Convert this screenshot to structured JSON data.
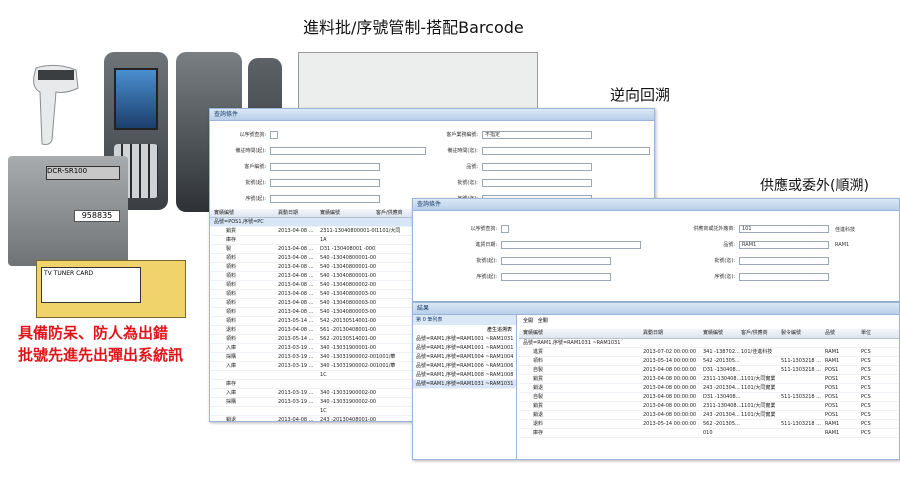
{
  "title": "進料批/序號管制-搭配Barcode",
  "captions": {
    "reverse": "逆向回溯",
    "forward": "供應或委外(順溯)"
  },
  "red_text": {
    "line1": "具備防呆、防人為出錯",
    "line2": "批號先進先出彈出系統訊"
  },
  "photos": {
    "camera_tag": "DCR-SR100",
    "camera_serial": "958835",
    "card_label": "TV TUNER CARD"
  },
  "win1": {
    "title": "查詢條件",
    "fields_left": [
      "以序號查詢:",
      "備註時間(起):",
      "客戶編號:",
      "批號(起):",
      "序號(起):"
    ],
    "fields_right": [
      "客戶業務編號:",
      "備註時間(迄):",
      "品號:",
      "批號(迄):",
      "序號(迄):"
    ],
    "right_value": "不指定",
    "columns": [
      "實績編號",
      "異動日期",
      "實績編號",
      "客戶/供應商"
    ],
    "rows": [
      {
        "name": "品號=POS1,序號=PC",
        "date": "",
        "no": "",
        "cust": ""
      },
      {
        "name": "銷貨",
        "date": "2013-04-08 ...",
        "no": "2311-13040800001-0001",
        "cust": "1101/大同"
      },
      {
        "name": "庫存",
        "date": "",
        "no": "1A",
        "cust": ""
      },
      {
        "name": "製",
        "date": "2013-04-08 ...",
        "no": "D31 -130408001 -0001",
        "cust": ""
      },
      {
        "name": "領料",
        "date": "2013-04-08 ...",
        "no": "540 -13040800001-0001",
        "cust": ""
      },
      {
        "name": "領料",
        "date": "2013-04-08 ...",
        "no": "540 -13040800001-0002",
        "cust": ""
      },
      {
        "name": "領料",
        "date": "2013-04-08 ...",
        "no": "540 -13040800001-0003",
        "cust": ""
      },
      {
        "name": "領料",
        "date": "2013-04-08 ...",
        "no": "540 -13040800002-0001",
        "cust": ""
      },
      {
        "name": "領料",
        "date": "2013-04-08 ...",
        "no": "540 -13040800003-0001",
        "cust": ""
      },
      {
        "name": "領料",
        "date": "2013-04-08 ...",
        "no": "540 -13040800003-0002",
        "cust": ""
      },
      {
        "name": "領料",
        "date": "2013-04-08 ...",
        "no": "540 -13040800003-0003",
        "cust": ""
      },
      {
        "name": "領料",
        "date": "2013-05-14 ...",
        "no": "542 -20130514001-0001",
        "cust": ""
      },
      {
        "name": "退料",
        "date": "2013-04-08 ...",
        "no": "561 -20130408001-0001",
        "cust": ""
      },
      {
        "name": "領料",
        "date": "2013-05-14 ...",
        "no": "562 -20130514001-0001",
        "cust": ""
      },
      {
        "name": "入庫",
        "date": "2013-03-19 ...",
        "no": "340 -13031900001-0001",
        "cust": ""
      },
      {
        "name": "採購",
        "date": "2013-03-19 ...",
        "no": "340 -13031900002-0001",
        "cust": "1001/華"
      },
      {
        "name": "入庫",
        "date": "2013-03-19 ...",
        "no": "340 -13031900002-0002",
        "cust": "1001/華"
      },
      {
        "name": "",
        "date": "",
        "no": "1C",
        "cust": ""
      },
      {
        "name": "庫存",
        "date": "",
        "no": "",
        "cust": ""
      },
      {
        "name": "入庫",
        "date": "2013-03-19 ...",
        "no": "340 -13031900002-0003",
        "cust": ""
      },
      {
        "name": "採購",
        "date": "2013-03-19 ...",
        "no": "340 -13031900002-0002",
        "cust": ""
      },
      {
        "name": "",
        "date": "",
        "no": "1C",
        "cust": ""
      },
      {
        "name": "銷退",
        "date": "2013-04-08 ...",
        "no": "243 -20130408001-0001",
        "cust": ""
      }
    ]
  },
  "win2": {
    "title": "查詢條件",
    "fields_left": [
      "以序號查詢:",
      "進貨日期:",
      "批號(起):",
      "序號(起):"
    ],
    "fields_right": [
      "供應商或託外廠商:",
      "品號:",
      "批號(迄):",
      "序號(迄):"
    ],
    "vendor_value": "101",
    "vendor_name": "佳進科技",
    "item_value": "RAM1",
    "item_name": "RAM1"
  },
  "win3": {
    "title": "結果",
    "panel_title": "第 0 筆列表",
    "panel_sub": "產生追溯表",
    "list": [
      "品號=RAM1,序號=RAM1001 ~RAM1031",
      "品號=RAM1,序號=RAM1001 ~RAM1001",
      "品號=RAM1,序號=RAM1004 ~RAM1004",
      "品號=RAM1,序號=RAM1006 ~RAM1006",
      "品號=RAM1,序號=RAM1008 ~RAM1008",
      "品號=RAM1,序號=RAM1031 ~RAM1031"
    ],
    "tabs": [
      "全開",
      "全關"
    ],
    "columns": [
      "實績編號",
      "異動日期",
      "實績編號",
      "客戶/供應商",
      "製令編號",
      "品號",
      "單位"
    ],
    "rows": [
      {
        "name": "品號=RAM1,序號=RAM1031 ~RAM1031",
        "date": "",
        "no": "",
        "cust": "",
        "mo": "",
        "item": "",
        "unit": ""
      },
      {
        "name": "進貨",
        "date": "2013-07-02 00:00:00",
        "no": "341 -138702...",
        "cust": "101/佳進科技",
        "mo": "",
        "item": "RAM1",
        "unit": "PCS"
      },
      {
        "name": "領料",
        "date": "2013-05-14 00:00:00",
        "no": "542 -201305...",
        "cust": "",
        "mo": "511-1303218 ...",
        "item": "RAM1",
        "unit": "PCS"
      },
      {
        "name": "自製",
        "date": "2013-04-08 00:00:00",
        "no": "D31 -130408...",
        "cust": "",
        "mo": "511-1303218 ...",
        "item": "POS1",
        "unit": "PCS"
      },
      {
        "name": "銷貨",
        "date": "2013-04-08 00:00:00",
        "no": "2311-130408...",
        "cust": "1101/大同實業",
        "mo": "",
        "item": "POS1",
        "unit": "PCS"
      },
      {
        "name": "銷退",
        "date": "2013-04-08 00:00:00",
        "no": "243 -201304...",
        "cust": "1101/大同實業",
        "mo": "",
        "item": "POS1",
        "unit": "PCS"
      },
      {
        "name": "自製",
        "date": "2013-04-08 00:00:00",
        "no": "D31 -130408...",
        "cust": "",
        "mo": "511-1303218 ...",
        "item": "POS1",
        "unit": "PCS"
      },
      {
        "name": "銷貨",
        "date": "2013-04-08 00:00:00",
        "no": "2311-130408...",
        "cust": "1101/大同實業",
        "mo": "",
        "item": "POS1",
        "unit": "PCS"
      },
      {
        "name": "銷退",
        "date": "2013-04-08 00:00:00",
        "no": "243 -201304...",
        "cust": "1101/大同實業",
        "mo": "",
        "item": "POS1",
        "unit": "PCS"
      },
      {
        "name": "退料",
        "date": "2013-05-14 00:00:00",
        "no": "562 -201305...",
        "cust": "",
        "mo": "511-1303218 ...",
        "item": "RAM1",
        "unit": "PCS"
      },
      {
        "name": "庫存",
        "date": "",
        "no": "010",
        "cust": "",
        "mo": "",
        "item": "RAM1",
        "unit": "PCS"
      }
    ]
  }
}
